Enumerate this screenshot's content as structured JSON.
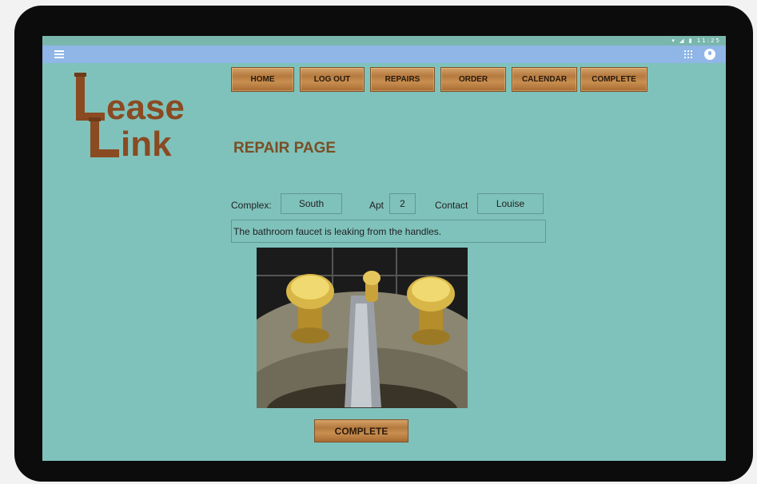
{
  "status_bar": {
    "time": "11:25"
  },
  "logo": {
    "word1_rest": "ease",
    "word2_rest": "ink",
    "initial": "L"
  },
  "nav": {
    "items": [
      "HOME",
      "LOG OUT",
      "REPAIRS",
      "ORDER",
      "CALENDAR",
      "COMPLETE"
    ]
  },
  "page": {
    "title": "REPAIR PAGE"
  },
  "form": {
    "complex_label": "Complex:",
    "complex_value": "South",
    "apt_label": "Apt",
    "apt_value": "2",
    "contact_label": "Contact",
    "contact_value": "Louise",
    "description": "The bathroom faucet is leaking from the handles."
  },
  "photo": {
    "subject": "leaking bathroom faucet with brass handles"
  },
  "actions": {
    "complete_label": "COMPLETE"
  },
  "colors": {
    "background": "#7fc2bb",
    "appbar": "#8fb6e6",
    "wood": "#b57a3f",
    "title": "#7a4e25",
    "logo": "#8a4a22"
  }
}
